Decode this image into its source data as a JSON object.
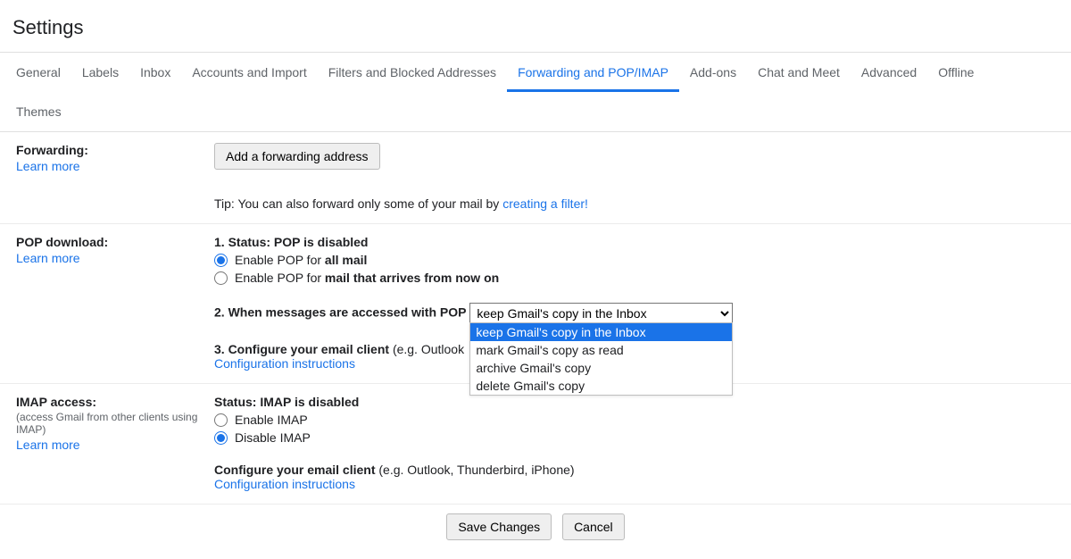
{
  "page_title": "Settings",
  "tabs": [
    "General",
    "Labels",
    "Inbox",
    "Accounts and Import",
    "Filters and Blocked Addresses",
    "Forwarding and POP/IMAP",
    "Add-ons",
    "Chat and Meet",
    "Advanced",
    "Offline",
    "Themes"
  ],
  "active_tab_index": 5,
  "forwarding": {
    "label": "Forwarding:",
    "learn_more": "Learn more",
    "add_button": "Add a forwarding address",
    "tip_prefix": "Tip: You can also forward only some of your mail by ",
    "tip_link": "creating a filter!"
  },
  "pop": {
    "label": "POP download:",
    "learn_more": "Learn more",
    "status_prefix": "1. Status: ",
    "status_value": "POP is disabled",
    "opt1_prefix": "Enable POP for ",
    "opt1_bold": "all mail",
    "opt2_prefix": "Enable POP for ",
    "opt2_bold": "mail that arrives from now on",
    "step2_label": "2. When messages are accessed with POP",
    "select_value": "keep Gmail's copy in the Inbox",
    "select_options": [
      "keep Gmail's copy in the Inbox",
      "mark Gmail's copy as read",
      "archive Gmail's copy",
      "delete Gmail's copy"
    ],
    "step3_prefix": "3. Configure your email client ",
    "step3_example": "(e.g. Outlook",
    "config_link": "Configuration instructions"
  },
  "imap": {
    "label": "IMAP access:",
    "sub": "(access Gmail from other clients using IMAP)",
    "learn_more": "Learn more",
    "status_prefix": "Status: ",
    "status_value": "IMAP is disabled",
    "opt_enable": "Enable IMAP",
    "opt_disable": "Disable IMAP",
    "config_prefix": "Configure your email client ",
    "config_example": "(e.g. Outlook, Thunderbird, iPhone)",
    "config_link": "Configuration instructions"
  },
  "actions": {
    "save": "Save Changes",
    "cancel": "Cancel"
  }
}
